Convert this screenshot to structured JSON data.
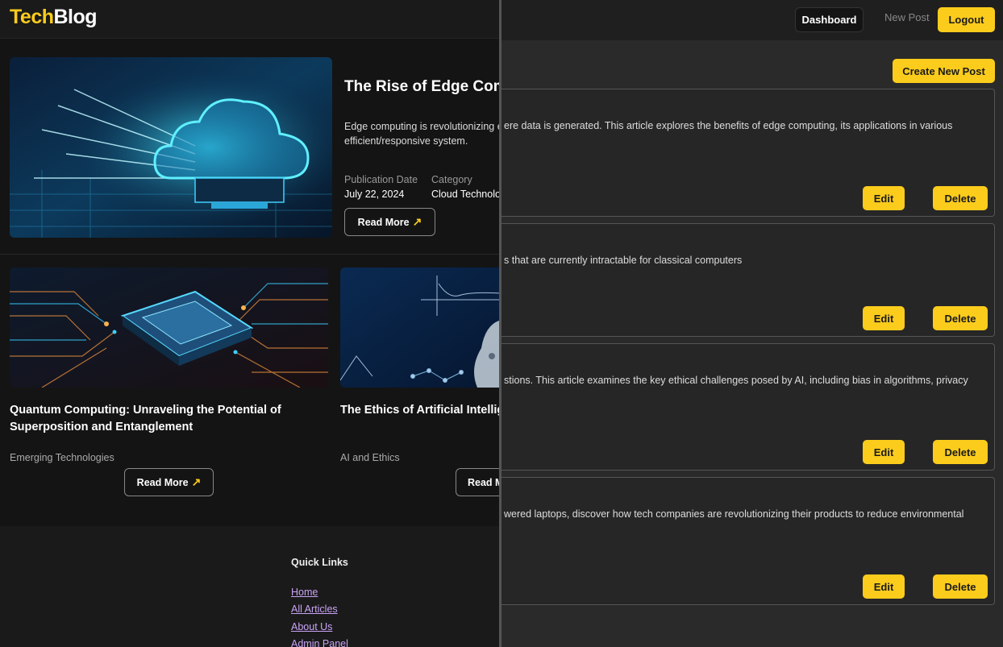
{
  "dashboard": {
    "nav": {
      "dashboard": "Dashboard",
      "new_post": "New Post",
      "logout": "Logout"
    },
    "create_button": "Create New Post",
    "posts": [
      {
        "excerpt": "ere data is generated. This article explores the benefits of edge computing, its applications in various",
        "edit": "Edit",
        "delete": "Delete"
      },
      {
        "excerpt": "s that are currently intractable for classical computers",
        "edit": "Edit",
        "delete": "Delete"
      },
      {
        "excerpt": "stions. This article examines the key ethical challenges posed by AI, including bias in algorithms, privacy",
        "edit": "Edit",
        "delete": "Delete"
      },
      {
        "excerpt": "wered laptops, discover how tech companies are revolutionizing their products to reduce environmental",
        "edit": "Edit",
        "delete": "Delete"
      }
    ]
  },
  "blog": {
    "logo": {
      "part1": "Tech",
      "part2": "Blog"
    },
    "featured": {
      "title": "The Rise of Edge Comp",
      "excerpt": "Edge computing is revolutionizing explores the benefits of edge com efficient/responsive system.",
      "pub_label": "Publication Date",
      "pub_value": "July 22, 2024",
      "cat_label": "Category",
      "cat_value": "Cloud Technolo",
      "read_more": "Read More",
      "image": "cloud-chip-image"
    },
    "cards": [
      {
        "title": "Quantum Computing: Unraveling the Potential of Superposition and Entanglement",
        "category": "Emerging Technologies",
        "read_more": "Read More",
        "image": "circuit-chip-image"
      },
      {
        "title": "The Ethics of Artificial Intellig Maze of Machine Learning",
        "category": "AI and Ethics",
        "read_more": "Read M",
        "image": "math-robot-image"
      }
    ],
    "footer": {
      "quick_links_title": "Quick Links",
      "links": [
        "Home",
        "All Articles",
        "About Us",
        "Admin Panel"
      ]
    }
  },
  "colors": {
    "accent": "#fccc1c",
    "background": "#141414",
    "link": "#c9a3f5"
  }
}
